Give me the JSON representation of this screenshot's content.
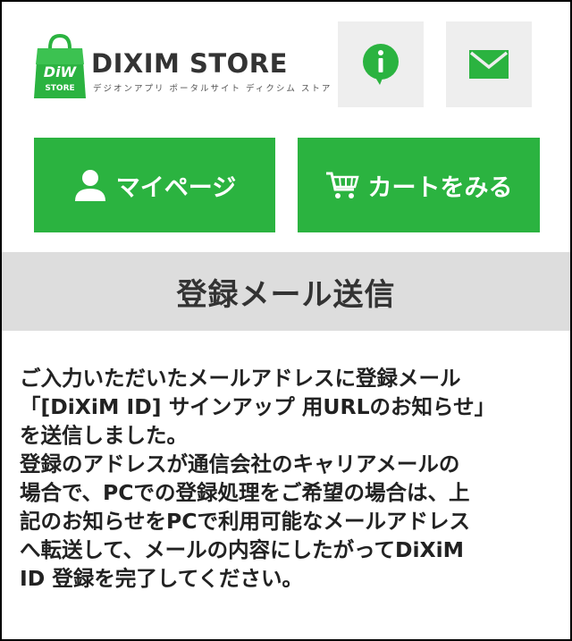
{
  "header": {
    "logo": {
      "bag_text_top": "DiW",
      "bag_text_bottom": "STORE",
      "brand_name": "DIXIM STORE",
      "brand_subtitle": "デジオンアプリ ポータルサイト ディクシム ストア"
    },
    "info_icon": "info-icon",
    "mail_icon": "mail-icon"
  },
  "nav": {
    "mypage_label": "マイページ",
    "cart_label": "カートをみる"
  },
  "page": {
    "title": "登録メール送信"
  },
  "message": {
    "lines": [
      "ご入力いただいたメールアドレスに登録メール",
      "「[DiXiM ID] サインアップ 用URLのお知らせ」",
      "を送信しました。",
      "登録のアドレスが通信会社のキャリアメールの",
      "場合で、PCでの登録処理をご希望の場合は、上",
      "記のお知らせをPCで利用可能なメールアドレス",
      "へ転送して、メールの内容にしたがってDiXiM",
      "ID 登録を完了してください。"
    ]
  },
  "colors": {
    "brand_green": "#2bb340",
    "icon_bg": "#eeeeee",
    "title_band_bg": "#dddddd",
    "text": "#222222"
  }
}
